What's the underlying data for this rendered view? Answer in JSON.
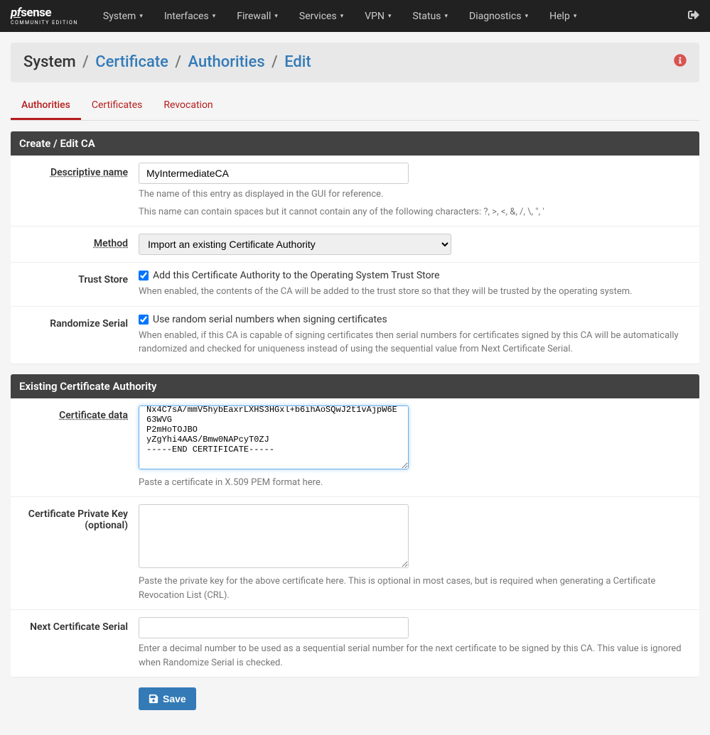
{
  "logo": {
    "main": "pfsense",
    "sub": "COMMUNITY EDITION"
  },
  "nav": [
    {
      "label": "System"
    },
    {
      "label": "Interfaces"
    },
    {
      "label": "Firewall"
    },
    {
      "label": "Services"
    },
    {
      "label": "VPN"
    },
    {
      "label": "Status"
    },
    {
      "label": "Diagnostics"
    },
    {
      "label": "Help"
    }
  ],
  "breadcrumb": {
    "root": "System",
    "l1": "Certificate",
    "l2": "Authorities",
    "l3": "Edit",
    "sep": "/"
  },
  "tabs": [
    {
      "label": "Authorities",
      "active": true
    },
    {
      "label": "Certificates",
      "active": false
    },
    {
      "label": "Revocation",
      "active": false
    }
  ],
  "panel1": {
    "title": "Create / Edit CA",
    "descriptive_name": {
      "label": "Descriptive name",
      "value": "MyIntermediateCA",
      "help1": "The name of this entry as displayed in the GUI for reference.",
      "help2": "This name can contain spaces but it cannot contain any of the following characters: ?, >, <, &, /, \\, \", '"
    },
    "method": {
      "label": "Method",
      "value": "Import an existing Certificate Authority"
    },
    "trust_store": {
      "label": "Trust Store",
      "checked": true,
      "checkbox_label": "Add this Certificate Authority to the Operating System Trust Store",
      "help": "When enabled, the contents of the CA will be added to the trust store so that they will be trusted by the operating system."
    },
    "randomize_serial": {
      "label": "Randomize Serial",
      "checked": true,
      "checkbox_label": "Use random serial numbers when signing certificates",
      "help": "When enabled, if this CA is capable of signing certificates then serial numbers for certificates signed by this CA will be automatically randomized and checked for uniqueness instead of using the sequential value from Next Certificate Serial."
    }
  },
  "panel2": {
    "title": "Existing Certificate Authority",
    "certificate_data": {
      "label": "Certificate data",
      "value": "Nx4C7sA/mmV5hybEaxrLXHS3HGxl+b6ihAoSQwJ2t1vAjpW6E63WVG\nP2mHoTOJBO\nyZgYhi4AAS/Bmw0NAPcyT0ZJ\n-----END CERTIFICATE-----\n",
      "help": "Paste a certificate in X.509 PEM format here."
    },
    "private_key": {
      "label": "Certificate Private Key (optional)",
      "value": "",
      "help": "Paste the private key for the above certificate here. This is optional in most cases, but is required when generating a Certificate Revocation List (CRL)."
    },
    "next_serial": {
      "label": "Next Certificate Serial",
      "value": "",
      "help": "Enter a decimal number to be used as a sequential serial number for the next certificate to be signed by this CA. This value is ignored when Randomize Serial is checked."
    }
  },
  "save_button": "Save"
}
